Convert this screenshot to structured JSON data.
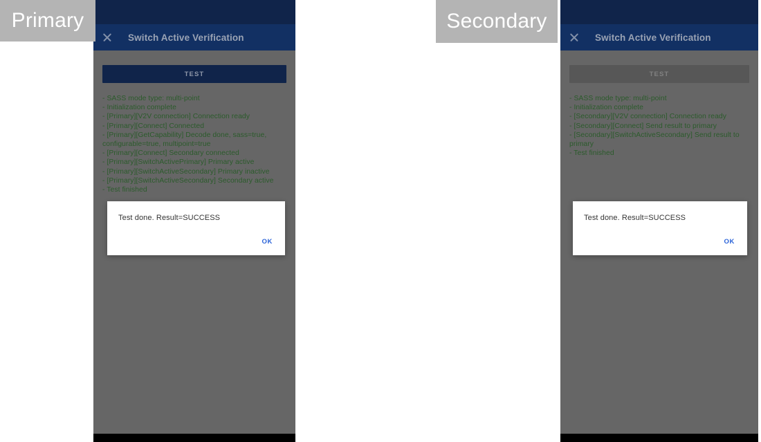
{
  "captions": {
    "primary": "Primary",
    "secondary": "Secondary"
  },
  "app_bar": {
    "title": "Switch Active Verification",
    "close_icon": "close-icon"
  },
  "primary_device": {
    "test_button_label": "TEST",
    "test_button_state": "enabled",
    "log_lines": [
      "- SASS mode type: multi-point",
      "- Initialization complete",
      "- [Primary][V2V connection] Connection ready",
      "- [Primary][Connect] Connected",
      "- [Primary][GetCapability] Decode done, sass=true, configurable=true, multipoint=true",
      "- [Primary][Connect] Secondary connected",
      "- [Primary][SwitchActivePrimary] Primary active",
      "- [Primary][SwitchActiveSecondary] Primary inactive",
      "- [Primary][SwitchActiveSecondary] Secondary active",
      "- Test finished"
    ],
    "dialog": {
      "message": "Test done. Result=SUCCESS",
      "ok_label": "OK"
    }
  },
  "secondary_device": {
    "test_button_label": "TEST",
    "test_button_state": "disabled",
    "log_lines": [
      "- SASS mode type: multi-point",
      "- Initialization complete",
      "- [Secondary][V2V connection] Connection ready",
      "- [Secondary][Connect] Send result to primary",
      "- [Secondary][SwitchActiveSecondary] Send result to primary",
      "- Test finished"
    ],
    "dialog": {
      "message": "Test done. Result=SUCCESS",
      "ok_label": "OK"
    }
  },
  "colors": {
    "status_bar": "#10244a",
    "app_bar": "#123063",
    "screen_scrim": "#666666",
    "log_text": "#2b5b2b",
    "accent_link": "#2962d8",
    "caption_bg": "#b4b4b4"
  }
}
